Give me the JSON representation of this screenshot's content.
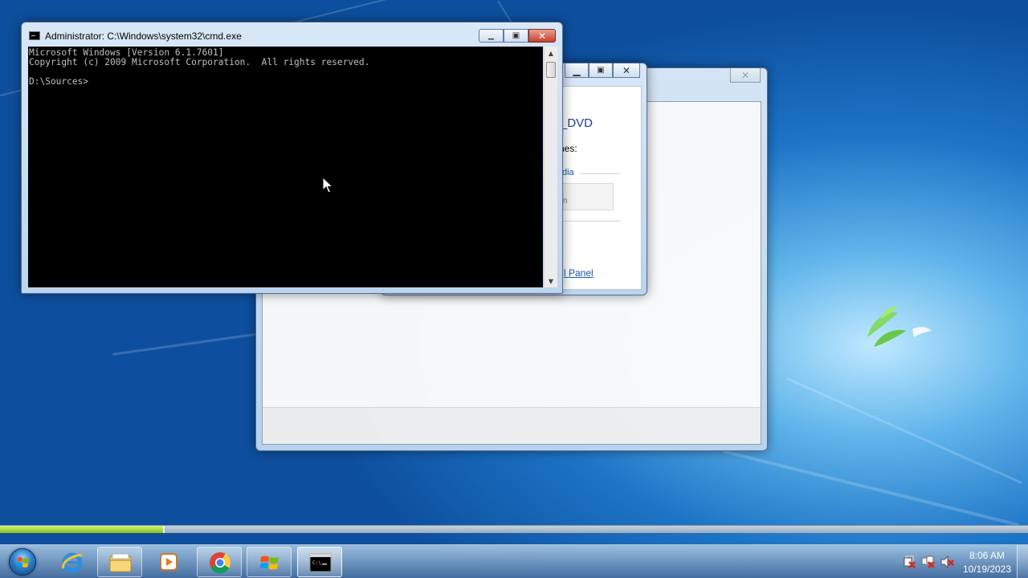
{
  "cmd_window": {
    "title": "Administrator: C:\\Windows\\system32\\cmd.exe",
    "console_lines": [
      "Microsoft Windows [Version 6.1.7601]",
      "Copyright (c) 2009 Microsoft Corporation.  All rights reserved.",
      "",
      "D:\\Sources>"
    ]
  },
  "install_dialog": {
    "partial_title": "_DVD",
    "partial_label": "nes:",
    "partial_link_media": "dia",
    "partial_button": "n",
    "partial_link_panel": "l Panel"
  },
  "progress": {
    "fraction": 0.16
  },
  "taskbar": {
    "items": [
      "start-orb",
      "internet-explorer-icon",
      "file-explorer-icon",
      "media-player-icon",
      "chrome-icon",
      "windows-setup-icon",
      "command-prompt-icon"
    ]
  },
  "tray": {
    "time": "8:06 AM",
    "date": "10/19/2023",
    "icons": [
      "action-center-icon",
      "network-icon",
      "volume-muted-icon"
    ]
  },
  "colors": {
    "desktop": "#1d74c6",
    "console_bg": "#000000",
    "console_text": "#c0c0c0",
    "progress_fill": "#86c11c",
    "link": "#1a55b5"
  }
}
